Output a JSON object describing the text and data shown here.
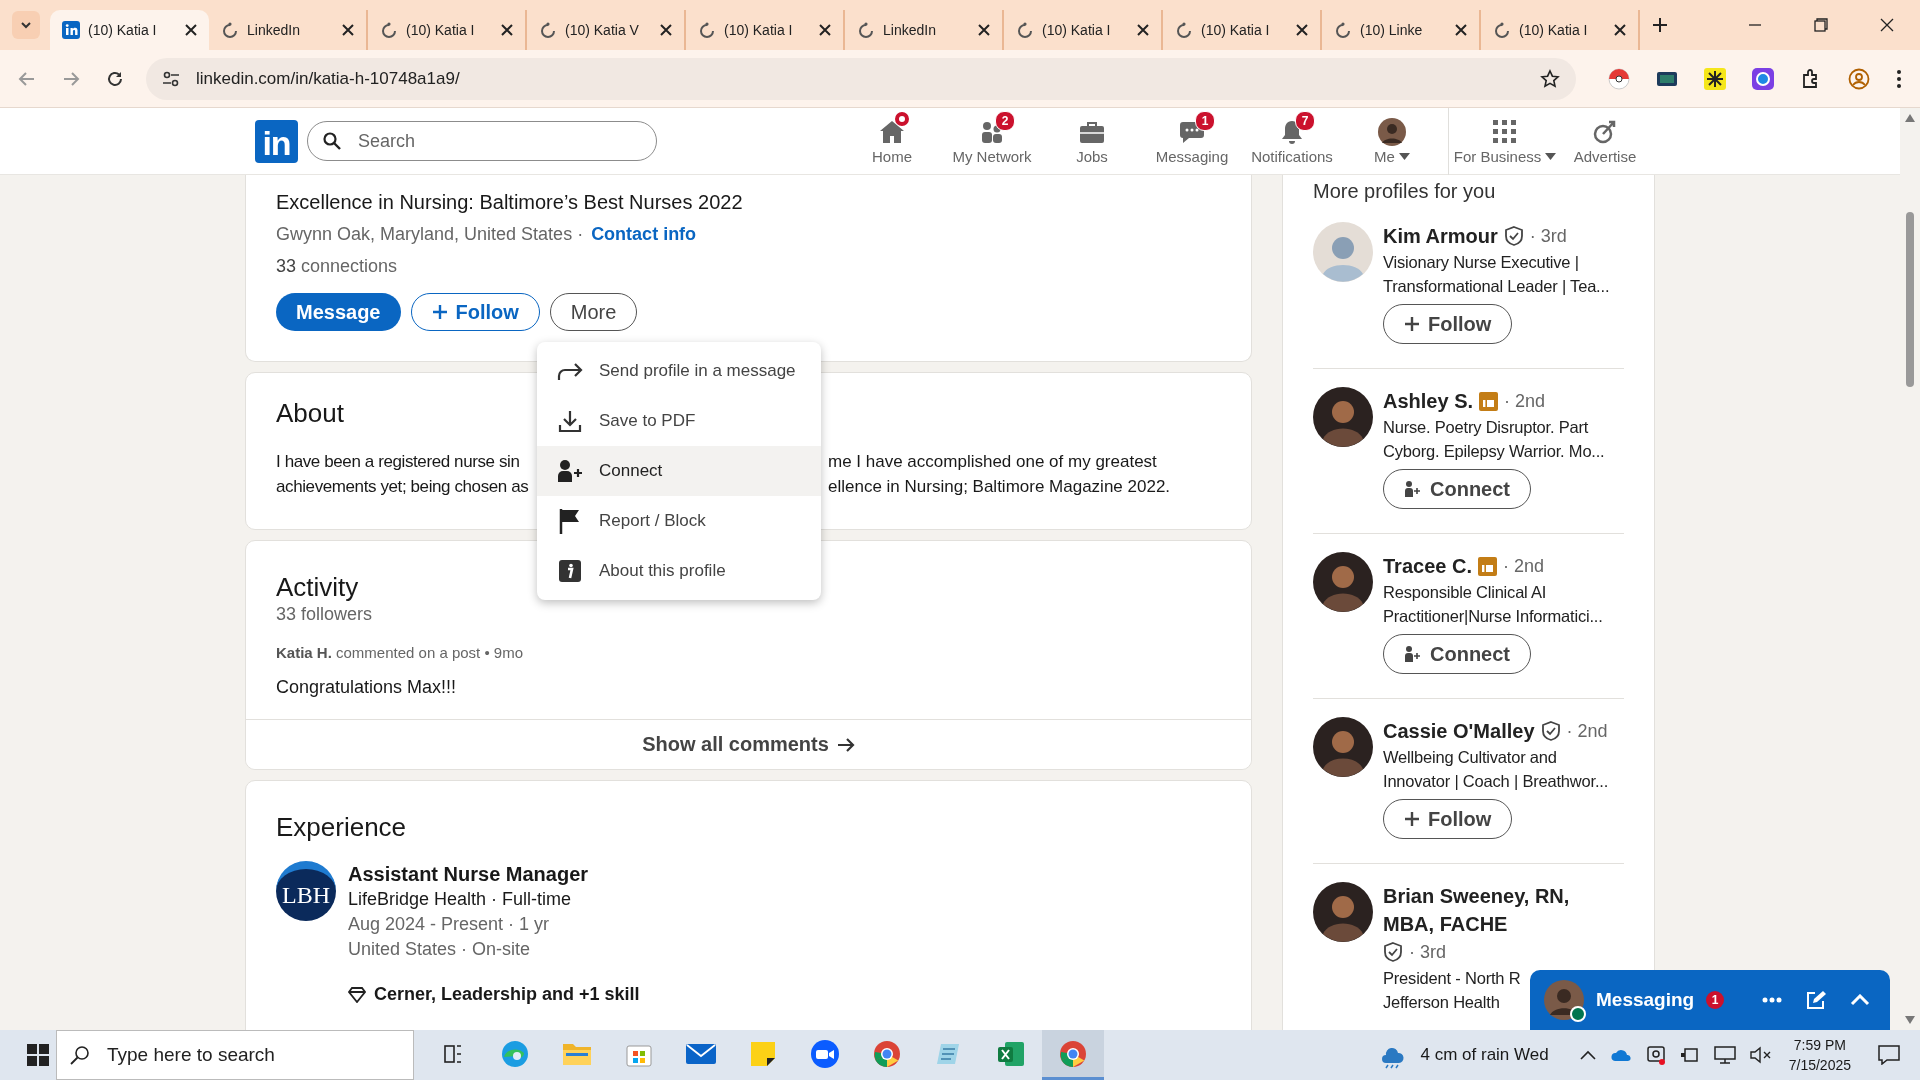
{
  "browser": {
    "tabs": [
      {
        "title": "(10) Katia I",
        "selected": true,
        "kind": "linkedin"
      },
      {
        "title": "LinkedIn",
        "selected": false,
        "kind": "loading"
      },
      {
        "title": "(10) Katia I",
        "selected": false,
        "kind": "loading"
      },
      {
        "title": "(10) Katia V",
        "selected": false,
        "kind": "loading"
      },
      {
        "title": "(10) Katia I",
        "selected": false,
        "kind": "loading"
      },
      {
        "title": "LinkedIn",
        "selected": false,
        "kind": "loading"
      },
      {
        "title": "(10) Katia I",
        "selected": false,
        "kind": "loading"
      },
      {
        "title": "(10) Katia I",
        "selected": false,
        "kind": "loading"
      },
      {
        "title": "(10) Linke",
        "selected": false,
        "kind": "loading"
      },
      {
        "title": "(10) Katia I",
        "selected": false,
        "kind": "loading"
      }
    ],
    "url": "linkedin.com/in/katia-h-10748a1a9/"
  },
  "nav": {
    "logo_text": "in",
    "search_placeholder": "Search",
    "items": [
      {
        "label": "Home",
        "badge_dot": true
      },
      {
        "label": "My Network",
        "badge": "2"
      },
      {
        "label": "Jobs"
      },
      {
        "label": "Messaging",
        "badge": "1"
      },
      {
        "label": "Notifications",
        "badge": "7"
      },
      {
        "label": "Me",
        "caret": true
      },
      {
        "label": "For Business",
        "caret": true
      },
      {
        "label": "Advertise"
      }
    ]
  },
  "profile": {
    "headline": "Excellence in Nursing: Baltimore’s Best Nurses 2022",
    "location": "Gwynn Oak, Maryland, United States ·",
    "contact_link": "Contact info",
    "connections": "**33** connections",
    "actions": [
      {
        "label": "Message",
        "kind": "primary"
      },
      {
        "label": "Follow",
        "kind": "follow"
      },
      {
        "label": "More",
        "kind": "secondary"
      }
    ]
  },
  "more_menu": {
    "items": [
      {
        "label": "Send profile in a message",
        "selected": false
      },
      {
        "label": "Save to PDF",
        "selected": false
      },
      {
        "label": "Connect",
        "selected": true
      },
      {
        "label": "Report / Block",
        "selected": false
      },
      {
        "label": "About this profile",
        "selected": false
      }
    ]
  },
  "about": {
    "title": "About",
    "lines": [
      {
        "left": "I have been a registered nurse sin",
        "right": "me I have accomplished one of my greatest"
      },
      {
        "left": "achievements yet; being chosen as",
        "right": "ellence in Nursing; Baltimore Magazine 2022."
      }
    ]
  },
  "activity": {
    "title": "Activity",
    "followers": "33 followers",
    "post_meta": "**Katia H.** commented on a post • 9mo",
    "comment": "Congratulations Max!!!",
    "show_all": "Show all comments"
  },
  "experience": {
    "title": "Experience",
    "items": [
      {
        "logo_text": "LBH",
        "role": "Assistant Nurse Manager",
        "company": "LifeBridge Health · Full-time",
        "dates": "Aug 2024 - Present · 1 yr",
        "location": "United States · On-site",
        "skills": "Cerner, Leadership and +1 skill"
      }
    ]
  },
  "suggestions": {
    "title": "More profiles for you",
    "profiles": [
      {
        "name": "Kim Armour",
        "kind": "verified",
        "degree": "· 3rd",
        "headline_lines": [
          "Visionary Nurse Executive |",
          "Transformational Leader | Tea..."
        ],
        "action": {
          "label": "Follow",
          "kind": "follow"
        }
      },
      {
        "name": "Ashley S.",
        "kind": "premium",
        "degree": "· 2nd",
        "headline_lines": [
          "Nurse. Poetry Disruptor. Part",
          "Cyborg. Epilepsy Warrior. Mo..."
        ],
        "action": {
          "label": "Connect",
          "kind": "connect"
        }
      },
      {
        "name": "Tracee C.",
        "kind": "premium",
        "degree": "· 2nd",
        "headline_lines": [
          "Responsible Clinical AI",
          "Practitioner|Nurse Informatici..."
        ],
        "action": {
          "label": "Connect",
          "kind": "connect"
        }
      },
      {
        "name": "Cassie O'Malley",
        "kind": "verified",
        "degree": "· 2nd",
        "headline_lines": [
          "Wellbeing Cultivator and",
          "Innovator | Coach | Breathwor..."
        ],
        "action": {
          "label": "Follow",
          "kind": "follow"
        }
      },
      {
        "name": "Brian Sweeney, RN, MBA, FACHE",
        "kind": "verified",
        "degree": "· 3rd",
        "headline_lines": [
          "President - North R",
          "Jefferson Health"
        ]
      }
    ]
  },
  "messaging": {
    "label": "Messaging",
    "badge": "1",
    "online": true
  },
  "taskbar": {
    "search_placeholder": "Type here to search",
    "apps": [
      {
        "kind": "task-view",
        "selected": false
      },
      {
        "kind": "edge",
        "selected": false
      },
      {
        "kind": "folder",
        "selected": false
      },
      {
        "kind": "store",
        "selected": false
      },
      {
        "kind": "mail",
        "selected": false
      },
      {
        "kind": "sticky",
        "selected": false
      },
      {
        "kind": "zoom",
        "selected": false
      },
      {
        "kind": "chrome",
        "selected": false
      },
      {
        "kind": "notepad",
        "selected": false
      },
      {
        "kind": "excel",
        "selected": false
      },
      {
        "kind": "chrome",
        "selected": true
      }
    ],
    "weather": "4 cm of rain Wed",
    "time": "7:59 PM",
    "date": "7/15/2025"
  }
}
